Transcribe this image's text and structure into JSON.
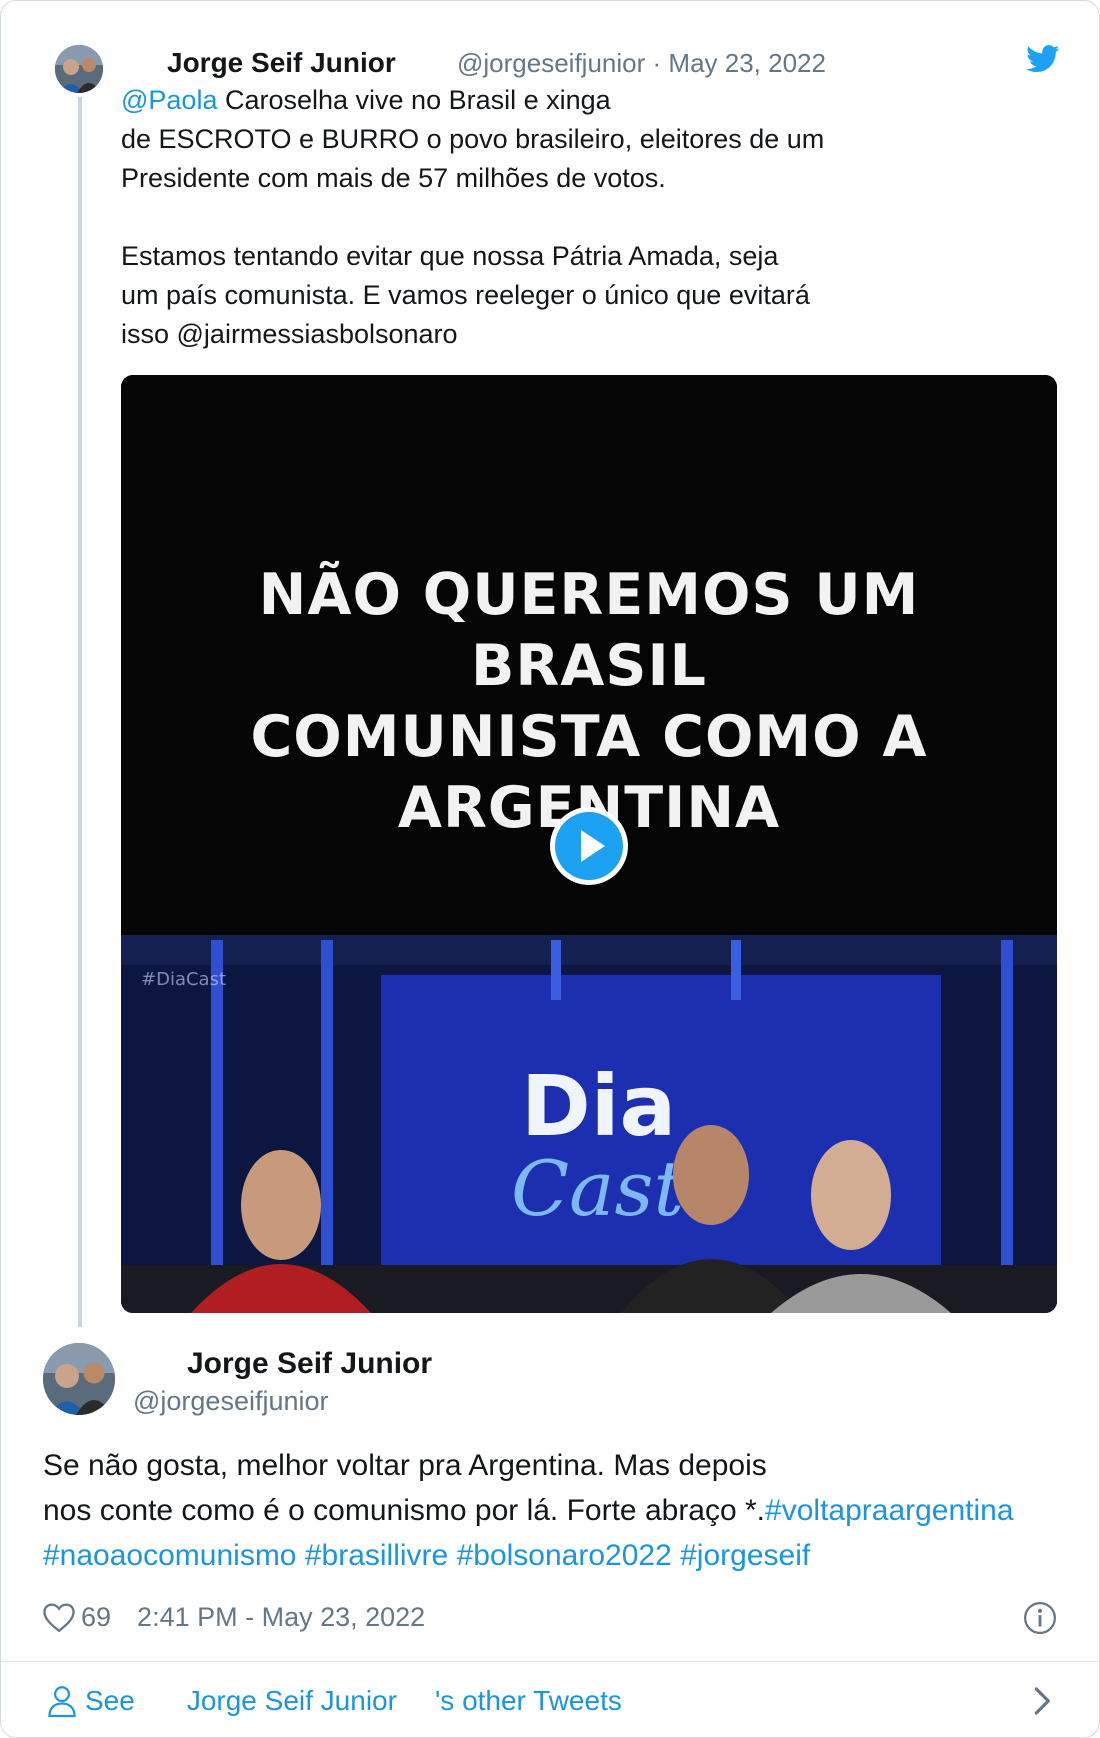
{
  "colors": {
    "link": "#1b95e0",
    "muted": "#657786",
    "brand": "#1da1f2",
    "line": "#ccd6dd"
  },
  "top_tweet": {
    "author_name": "Jorge Seif Junior",
    "handle": "@jorgeseifjunior",
    "separator": "·",
    "date": "May 23, 2022",
    "brand_icon": "twitter-bird-icon",
    "text": {
      "mention": "@Paola",
      "line1": " Caroselha vive no Brasil e xinga",
      "line2": "de ESCROTO e BURRO o povo brasileiro, eleitores de um",
      "line3": "Presidente com mais de 57 milhões de votos.",
      "line4": "Estamos tentando evitar que nossa Pátria Amada, seja",
      "line5": "um país comunista. E vamos reeleger o único que evitará",
      "line6": "isso @jairmessiasbolsonaro"
    },
    "video": {
      "caption_line1": "NÃO QUEREMOS UM",
      "caption_line2": "BRASIL",
      "caption_line3": "COMUNISTA COMO A",
      "caption_line4": "ARGENTINA",
      "play_icon": "play-icon"
    }
  },
  "main_tweet": {
    "author_name": "Jorge Seif Junior",
    "handle": "@jorgeseifjunior",
    "text": {
      "line1": "Se não gosta, melhor voltar pra Argentina. Mas depois",
      "line2": "nos conte como é o comunismo por lá. Forte abraço *.",
      "hashtag1": "#voltapraargentina",
      "hashtag2": "#naoaocomunismo",
      "hashtag3": "#brasillivre",
      "hashtag4": "#bolsonaro2022",
      "hashtag5": "#jorgeseif"
    },
    "likes": "69",
    "timestamp": "2:41 PM - May 23, 2022",
    "like_icon": "heart-icon",
    "info_icon": "info-icon"
  },
  "footer": {
    "see_label": "See",
    "name": "Jorge Seif Junior",
    "suffix": "'s other Tweets",
    "user_icon": "person-icon",
    "chevron_icon": "chevron-right-icon"
  }
}
